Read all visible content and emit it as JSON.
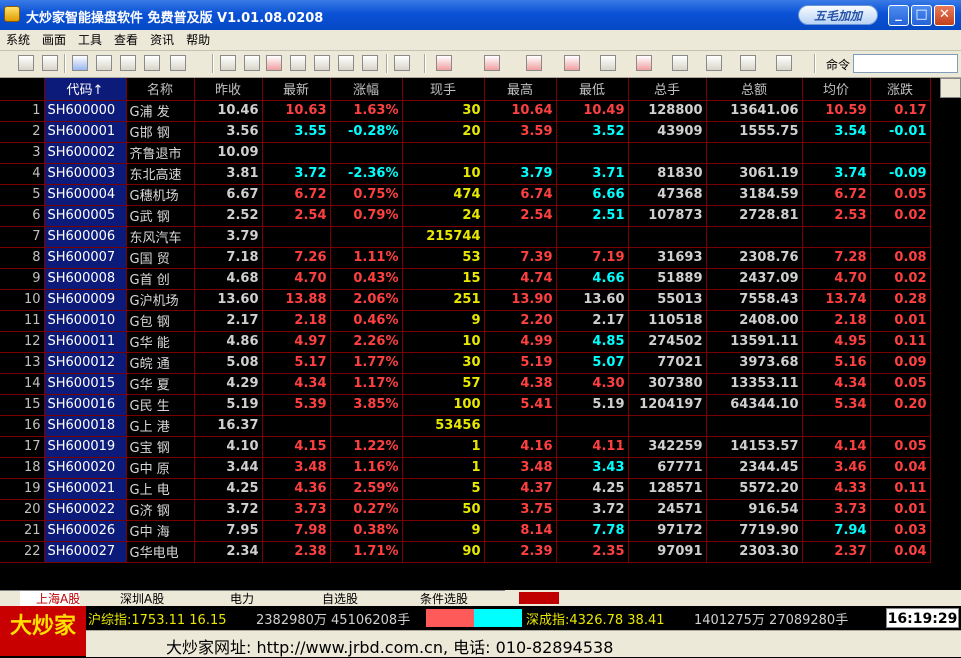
{
  "window": {
    "title": "大炒家智能操盘软件  免费普及版 V1.01.08.0208",
    "brand_button": "五毛加加"
  },
  "menu": [
    "系统",
    "画面",
    "工具",
    "查看",
    "资讯",
    "帮助"
  ],
  "toolbar": {
    "command_label": "命令",
    "command_value": ""
  },
  "table": {
    "headers": [
      "",
      "代码↑",
      "名称",
      "昨收",
      "最新",
      "涨幅",
      "现手",
      "最高",
      "最低",
      "总手",
      "总额",
      "均价",
      "涨跌"
    ],
    "rows": [
      [
        "1",
        "SH600000",
        "G浦 发",
        "10.46",
        "10.63",
        "1.63%",
        "30",
        "10.64",
        "10.49",
        "128800",
        "13641.06",
        "10.59",
        "0.17"
      ],
      [
        "2",
        "SH600001",
        "G邯 钢",
        "3.56",
        "3.55",
        "-0.28%",
        "20",
        "3.59",
        "3.52",
        "43909",
        "1555.75",
        "3.54",
        "-0.01"
      ],
      [
        "3",
        "SH600002",
        "齐鲁退市",
        "10.09",
        "",
        "",
        "",
        "",
        "",
        "",
        "",
        "",
        ""
      ],
      [
        "4",
        "SH600003",
        "东北高速",
        "3.81",
        "3.72",
        "-2.36%",
        "10",
        "3.79",
        "3.71",
        "81830",
        "3061.19",
        "3.74",
        "-0.09"
      ],
      [
        "5",
        "SH600004",
        "G穗机场",
        "6.67",
        "6.72",
        "0.75%",
        "474",
        "6.74",
        "6.66",
        "47368",
        "3184.59",
        "6.72",
        "0.05"
      ],
      [
        "6",
        "SH600005",
        "G武 钢",
        "2.52",
        "2.54",
        "0.79%",
        "24",
        "2.54",
        "2.51",
        "107873",
        "2728.81",
        "2.53",
        "0.02"
      ],
      [
        "7",
        "SH600006",
        "东风汽车",
        "3.79",
        "",
        "",
        "215744",
        "",
        "",
        "",
        "",
        "",
        ""
      ],
      [
        "8",
        "SH600007",
        "G国 贸",
        "7.18",
        "7.26",
        "1.11%",
        "53",
        "7.39",
        "7.19",
        "31693",
        "2308.76",
        "7.28",
        "0.08"
      ],
      [
        "9",
        "SH600008",
        "G首 创",
        "4.68",
        "4.70",
        "0.43%",
        "15",
        "4.74",
        "4.66",
        "51889",
        "2437.09",
        "4.70",
        "0.02"
      ],
      [
        "10",
        "SH600009",
        "G沪机场",
        "13.60",
        "13.88",
        "2.06%",
        "251",
        "13.90",
        "13.60",
        "55013",
        "7558.43",
        "13.74",
        "0.28"
      ],
      [
        "11",
        "SH600010",
        "G包 钢",
        "2.17",
        "2.18",
        "0.46%",
        "9",
        "2.20",
        "2.17",
        "110518",
        "2408.00",
        "2.18",
        "0.01"
      ],
      [
        "12",
        "SH600011",
        "G华 能",
        "4.86",
        "4.97",
        "2.26%",
        "10",
        "4.99",
        "4.85",
        "274502",
        "13591.11",
        "4.95",
        "0.11"
      ],
      [
        "13",
        "SH600012",
        "G皖 通",
        "5.08",
        "5.17",
        "1.77%",
        "30",
        "5.19",
        "5.07",
        "77021",
        "3973.68",
        "5.16",
        "0.09"
      ],
      [
        "14",
        "SH600015",
        "G华 夏",
        "4.29",
        "4.34",
        "1.17%",
        "57",
        "4.38",
        "4.30",
        "307380",
        "13353.11",
        "4.34",
        "0.05"
      ],
      [
        "15",
        "SH600016",
        "G民 生",
        "5.19",
        "5.39",
        "3.85%",
        "100",
        "5.41",
        "5.19",
        "1204197",
        "64344.10",
        "5.34",
        "0.20"
      ],
      [
        "16",
        "SH600018",
        "G上 港",
        "16.37",
        "",
        "",
        "53456",
        "",
        "",
        "",
        "",
        "",
        ""
      ],
      [
        "17",
        "SH600019",
        "G宝 钢",
        "4.10",
        "4.15",
        "1.22%",
        "1",
        "4.16",
        "4.11",
        "342259",
        "14153.57",
        "4.14",
        "0.05"
      ],
      [
        "18",
        "SH600020",
        "G中 原",
        "3.44",
        "3.48",
        "1.16%",
        "1",
        "3.48",
        "3.43",
        "67771",
        "2344.45",
        "3.46",
        "0.04"
      ],
      [
        "19",
        "SH600021",
        "G上 电",
        "4.25",
        "4.36",
        "2.59%",
        "5",
        "4.37",
        "4.25",
        "128571",
        "5572.20",
        "4.33",
        "0.11"
      ],
      [
        "20",
        "SH600022",
        "G济 钢",
        "3.72",
        "3.73",
        "0.27%",
        "50",
        "3.75",
        "3.72",
        "24571",
        "916.54",
        "3.73",
        "0.01"
      ],
      [
        "21",
        "SH600026",
        "G中 海",
        "7.95",
        "7.98",
        "0.38%",
        "9",
        "8.14",
        "7.78",
        "97172",
        "7719.90",
        "7.94",
        "0.03"
      ],
      [
        "22",
        "SH600027",
        "G华电电",
        "2.34",
        "2.38",
        "1.71%",
        "90",
        "2.39",
        "2.35",
        "97091",
        "2303.30",
        "2.37",
        "0.04"
      ]
    ]
  },
  "tabs": [
    "上海A股",
    "深圳A股",
    "电力",
    "自选股",
    "条件选股"
  ],
  "status": {
    "logo": "大炒家",
    "sh_index": "沪综指:1753.11 16.15",
    "sh_volume": "2382980万 45106208手",
    "sz_index": "深成指:4326.78 38.41",
    "sz_volume": "1401275万 27089280手",
    "time": "16:19:29"
  },
  "ad": {
    "text": "大炒家网址: http://www.jrbd.com.cn, 电话: 010-82894538"
  }
}
